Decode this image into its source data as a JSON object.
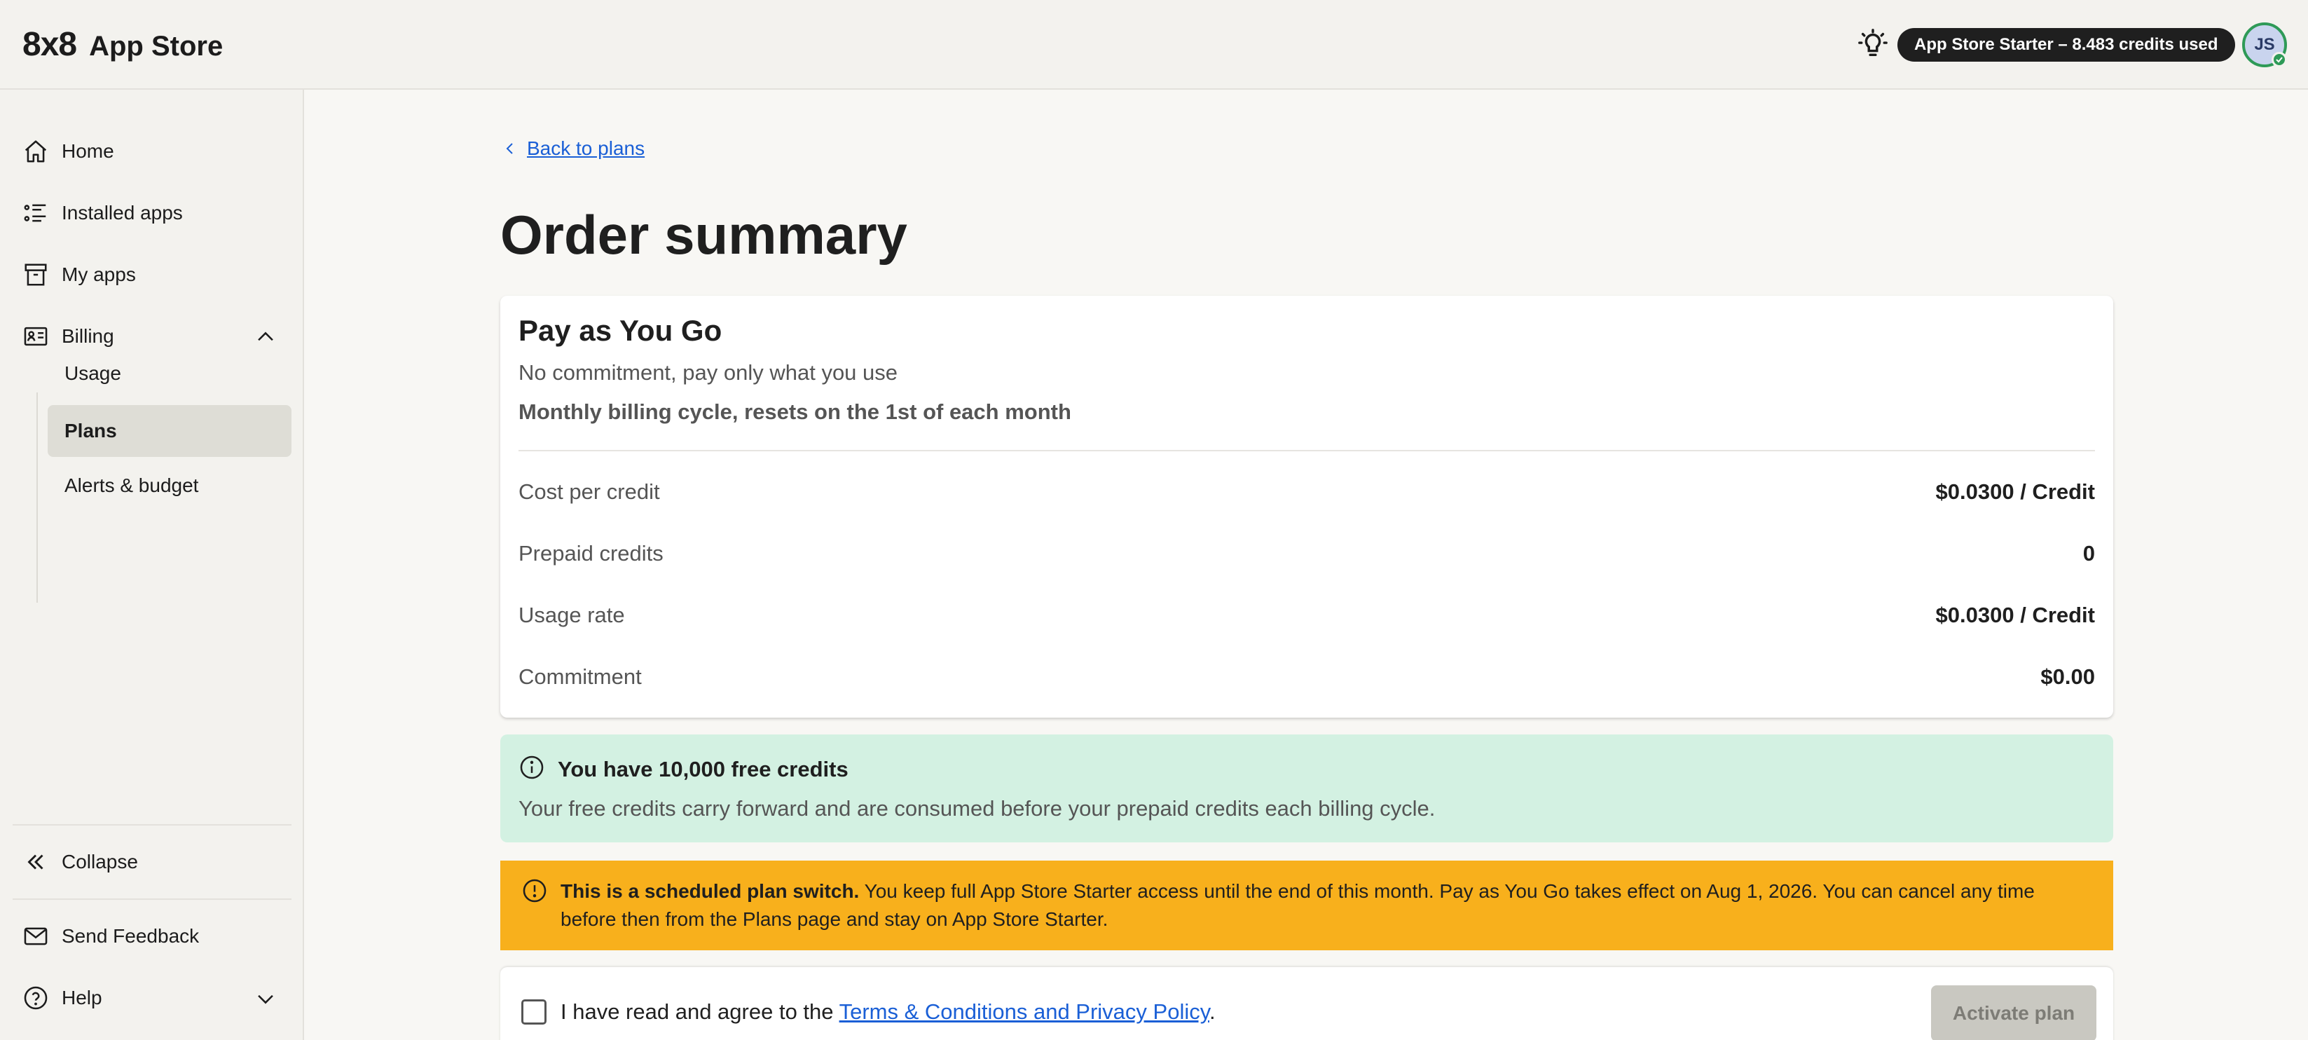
{
  "header": {
    "logo_mark": "8x8",
    "app_name": "App Store",
    "credit_badge": "App Store Starter – 8.483 credits used",
    "avatar_initials": "JS",
    "icons": {
      "tips": "lightbulb-icon",
      "status": "check-icon"
    }
  },
  "sidebar": {
    "items": [
      {
        "label": "Home",
        "icon": "home-icon"
      },
      {
        "label": "Installed apps",
        "icon": "list-icon"
      },
      {
        "label": "My apps",
        "icon": "archive-icon"
      },
      {
        "label": "Billing",
        "icon": "id-card-icon",
        "expanded": true
      }
    ],
    "billing_sub": [
      {
        "label": "Usage"
      },
      {
        "label": "Plans",
        "active": true
      },
      {
        "label": "Alerts & budget"
      }
    ],
    "collapse_label": "Collapse",
    "feedback_label": "Send Feedback",
    "help_label": "Help"
  },
  "main": {
    "back_label": "Back to plans",
    "title": "Order summary",
    "plan": {
      "name": "Pay as You Go",
      "subtitle": "No commitment, pay only what you use",
      "cycle": "Monthly billing cycle, resets on the 1st of each month",
      "rows": [
        {
          "label": "Cost per credit",
          "value": "$0.0300 / Credit"
        },
        {
          "label": "Prepaid credits",
          "value": "0"
        },
        {
          "label": "Usage rate",
          "value": "$0.0300 / Credit"
        },
        {
          "label": "Commitment",
          "value": "$0.00"
        }
      ]
    },
    "info": {
      "title": "You have 10,000 free credits",
      "text": "Your free credits carry forward and are consumed before your prepaid credits each billing cycle."
    },
    "warning": {
      "bold": "This is a scheduled plan switch.",
      "text": " You keep full App Store Starter access until the end of this month. Pay as You Go takes effect on Aug 1, 2026. You can cancel any time before then from the Plans page and stay on App Store Starter."
    },
    "agree": {
      "prefix": "I have read and agree to the ",
      "link": "Terms & Conditions and Privacy Policy",
      "suffix": ".",
      "button": "Activate plan"
    }
  },
  "colors": {
    "accent_link": "#1a5fd6",
    "info_bg": "#d3f1e2",
    "warning_bg": "#f8b01c",
    "badge_bg": "#1f1f1f",
    "status_green": "#2e9a57"
  }
}
